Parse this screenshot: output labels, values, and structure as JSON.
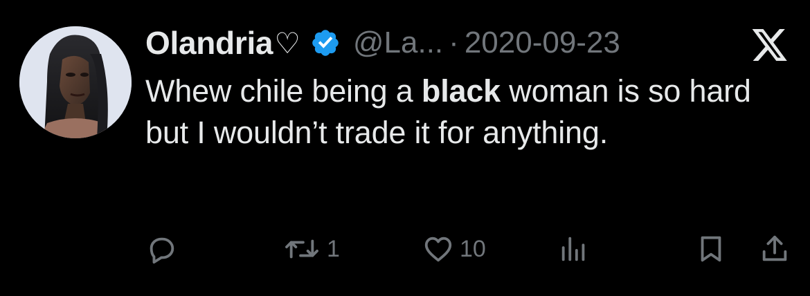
{
  "tweet": {
    "author": {
      "display_name": "Olandria",
      "name_emoji": "♡",
      "verified": true,
      "handle": "@La...",
      "avatar_icon": "avatar-photo"
    },
    "separator": "·",
    "date": "2020-09-23",
    "platform_icon": "x-logo-icon",
    "text_parts": [
      "Whew chile being a ",
      "black",
      " woman is so hard but I wouldn’t trade it for anything."
    ],
    "actions": {
      "reply_count": "",
      "retweet_count": "1",
      "like_count": "10",
      "views_count": ""
    }
  },
  "colors": {
    "background": "#000000",
    "primary_text": "#e7e9ea",
    "secondary_text": "#71767b",
    "verified_blue": "#1d9bf0"
  }
}
